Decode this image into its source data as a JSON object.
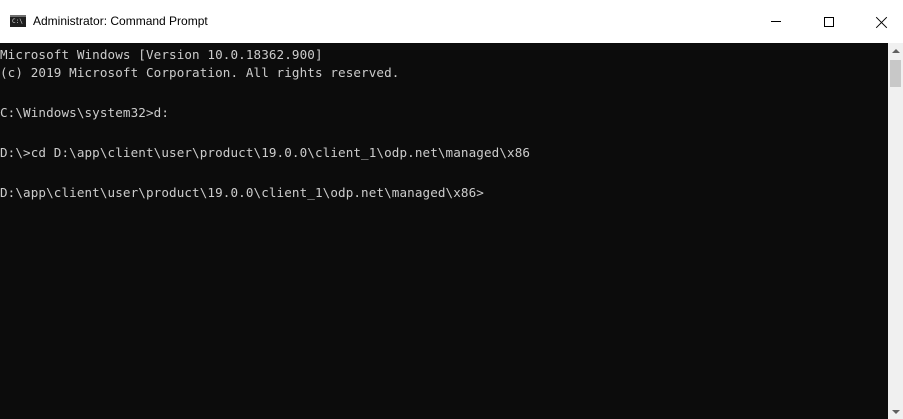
{
  "window": {
    "title": "Administrator: Command Prompt",
    "icon": "cmd-icon",
    "icon_glyph": "C:\\",
    "controls": {
      "minimize_icon": "minimize-icon",
      "maximize_icon": "maximize-icon",
      "close_icon": "close-icon"
    }
  },
  "console": {
    "background": "#0c0c0c",
    "text_color": "#cccccc",
    "lines": [
      "Microsoft Windows [Version 10.0.18362.900]",
      "(c) 2019 Microsoft Corporation. All rights reserved.",
      "",
      "C:\\Windows\\system32>d:",
      "",
      "D:\\>cd D:\\app\\client\\user\\product\\19.0.0\\client_1\\odp.net\\managed\\x86",
      "",
      "D:\\app\\client\\user\\product\\19.0.0\\client_1\\odp.net\\managed\\x86>"
    ]
  },
  "scrollbar": {
    "up_icon": "scroll-up-arrow-icon",
    "down_icon": "scroll-down-arrow-icon"
  }
}
